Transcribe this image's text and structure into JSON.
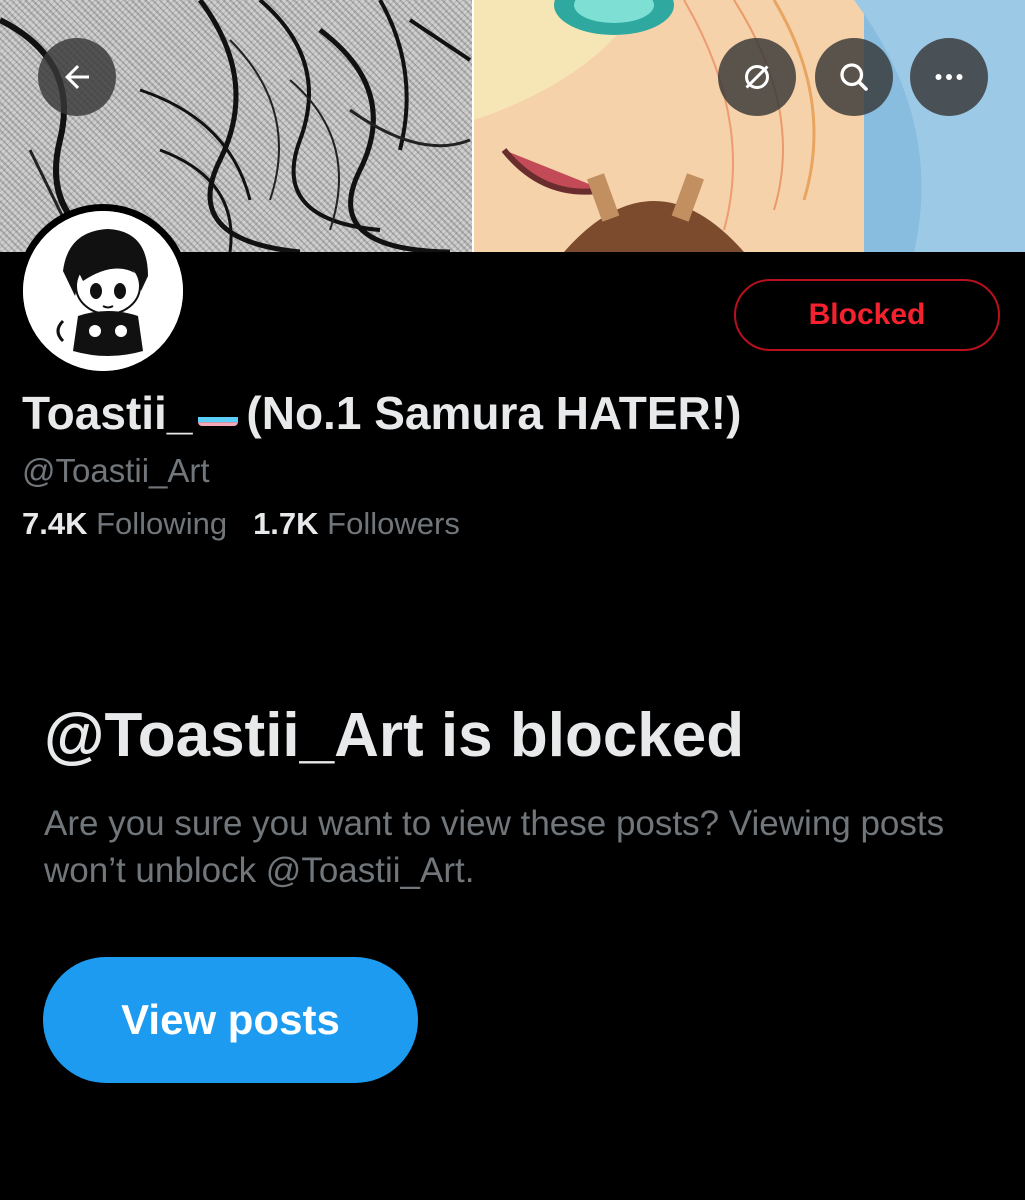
{
  "header": {
    "back_icon": "arrow-left-icon",
    "grok_icon": "slashed-circle-icon",
    "search_icon": "search-icon",
    "more_icon": "ellipsis-icon"
  },
  "profile": {
    "display_name_prefix": "Toastii_",
    "display_name_suffix": "(No.1 Samura HATER!)",
    "flag_icon": "transgender-flag-icon",
    "handle": "@Toastii_Art",
    "following_count": "7.4K",
    "following_label": "Following",
    "followers_count": "1.7K",
    "followers_label": "Followers",
    "blocked_label": "Blocked"
  },
  "blocked_notice": {
    "title": "@Toastii_Art is blocked",
    "description": "Are you sure you want to view these posts? Viewing posts won’t unblock @Toastii_Art.",
    "button_label": "View posts"
  },
  "colors": {
    "background": "#000000",
    "text_primary": "#e7e9ea",
    "text_secondary": "#71767b",
    "blocked_red": "#f4212e",
    "accent_blue": "#1d9bf0"
  }
}
